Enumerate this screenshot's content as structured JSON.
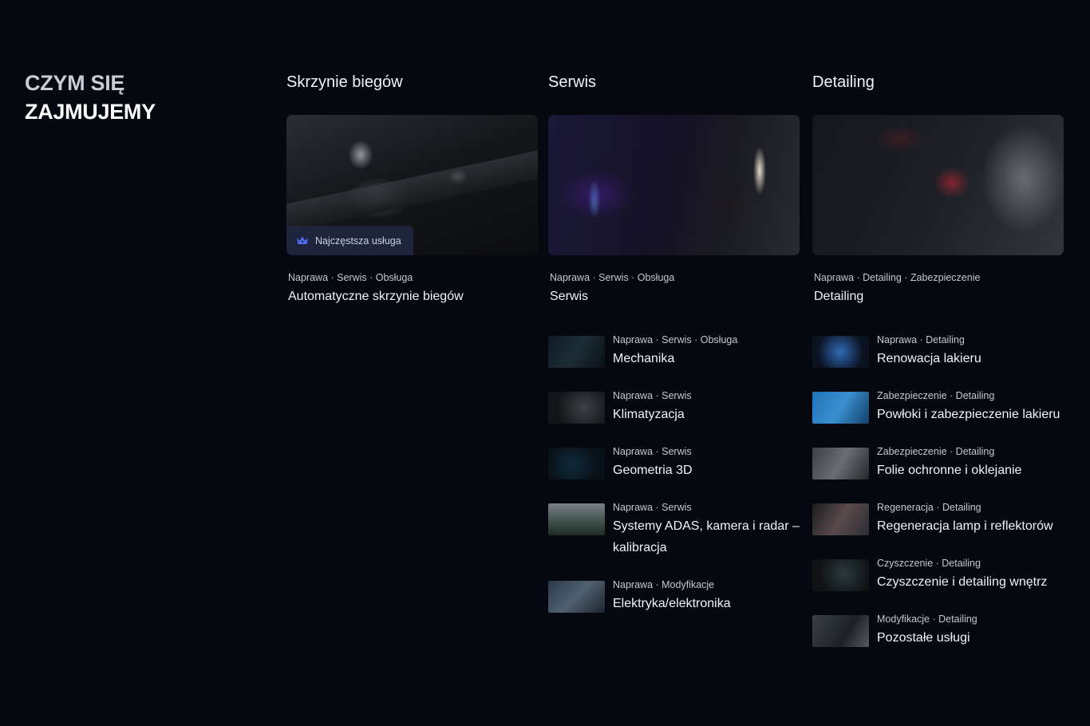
{
  "heading": {
    "line1": "CZYM SIĘ",
    "line2": "ZAJMUJEMY"
  },
  "columns": [
    {
      "title": "Skrzynie biegów",
      "hero": {
        "image": "gear-shifter-photo",
        "badge": "Najczęstsza usługa",
        "badge_icon": "crown-icon",
        "tags": "Naprawa · Serwis · Obsługa",
        "name": "Automatyczne skrzynie biegów"
      }
    },
    {
      "title": "Serwis",
      "hero": {
        "image": "workshop-mechanic-photo",
        "tags": "Naprawa · Serwis · Obsługa",
        "name": "Serwis"
      },
      "items": [
        {
          "tags": "Naprawa · Serwis · Obsługa",
          "name": "Mechanika"
        },
        {
          "tags": "Naprawa · Serwis",
          "name": "Klimatyzacja"
        },
        {
          "tags": "Naprawa · Serwis",
          "name": "Geometria 3D"
        },
        {
          "tags": "Naprawa · Serwis",
          "name": "Systemy ADAS, kamera i radar – kalibracja"
        },
        {
          "tags": "Naprawa · Modyfikacje",
          "name": "Elektryka/elektronika"
        }
      ]
    },
    {
      "title": "Detailing",
      "hero": {
        "image": "car-polishing-photo",
        "tags": "Naprawa · Detailing · Zabezpieczenie",
        "name": "Detailing"
      },
      "items": [
        {
          "tags": "Naprawa · Detailing",
          "name": "Renowacja lakieru"
        },
        {
          "tags": "Zabezpieczenie · Detailing",
          "name": "Powłoki i zabezpieczenie lakieru"
        },
        {
          "tags": "Zabezpieczenie · Detailing",
          "name": "Folie ochronne i oklejanie"
        },
        {
          "tags": "Regeneracja · Detailing",
          "name": "Regeneracja lamp i reflektorów"
        },
        {
          "tags": "Czyszczenie · Detailing",
          "name": "Czyszczenie i detailing wnętrz"
        },
        {
          "tags": "Modyfikacje · Detailing",
          "name": "Pozostałe usługi"
        }
      ]
    }
  ],
  "colors": {
    "background": "#05080f",
    "badge_bg": "#1f2640",
    "badge_icon": "#4f6ef7"
  }
}
